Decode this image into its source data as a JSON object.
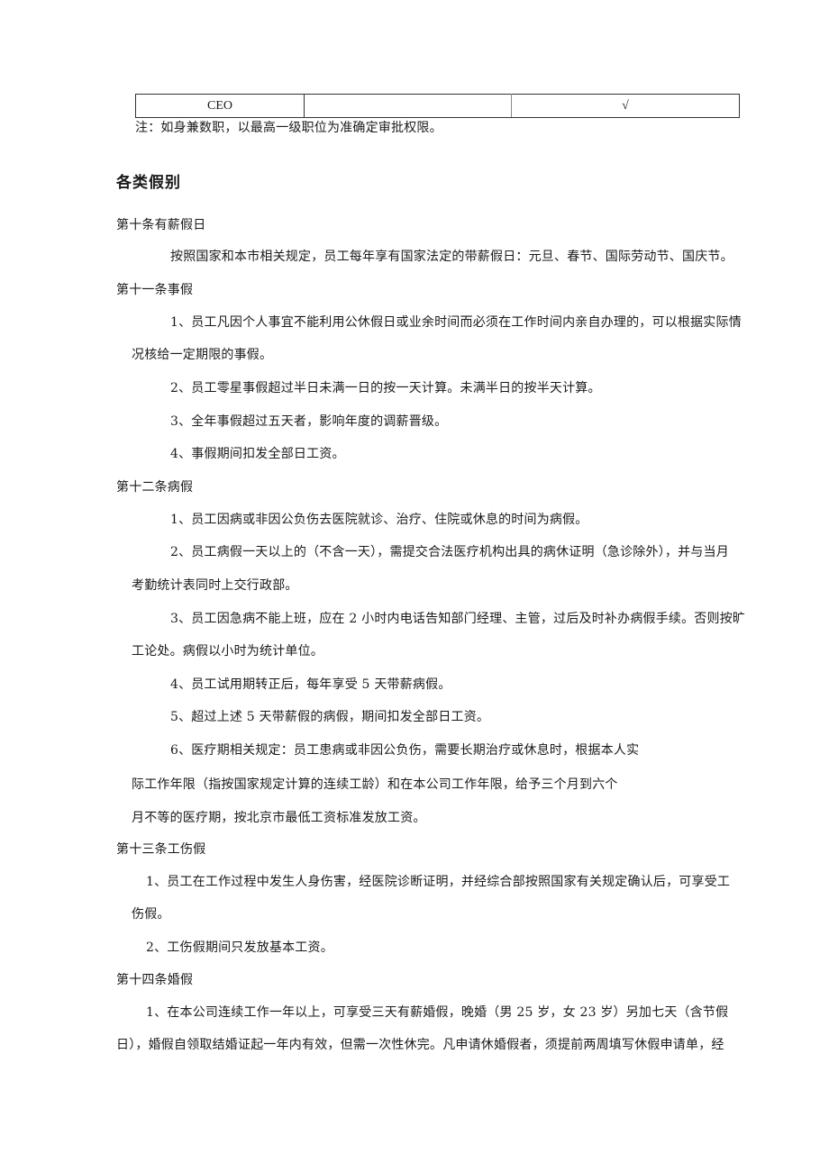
{
  "table": {
    "row": [
      "CEO",
      "",
      "√"
    ]
  },
  "note": "注：如身兼数职，以最高一级职位为准确定审批权限。",
  "section_title": "各类假别",
  "articles": {
    "a10": {
      "title": "第十条有薪假日",
      "lines": [
        "按照国家和本市相关规定，员工每年享有国家法定的带薪假日：元旦、春节、国际劳动节、国庆节。"
      ]
    },
    "a11": {
      "title": "第十一条事假",
      "lines": [
        "1、员工凡因个人事宜不能利用公休假日或业余时间而必须在工作时间内亲自办理的，可以根据实际情",
        "况核给一定期限的事假。",
        "2、员工零星事假超过半日未满一日的按一天计算。未满半日的按半天计算。",
        "3、全年事假超过五天者，影响年度的调薪晋级。",
        "4、事假期间扣发全部日工资。"
      ]
    },
    "a12": {
      "title": "第十二条病假",
      "lines": [
        "1、员工因病或非因公负伤去医院就诊、治疗、住院或休息的时间为病假。",
        "2、员工病假一天以上的（不含一天），需提交合法医疗机构出具的病休证明（急诊除外），并与当月",
        "考勤统计表同时上交行政部。",
        "3、员工因急病不能上班，应在 2 小时内电话告知部门经理、主管，过后及时补办病假手续。否则按旷",
        "工论处。病假以小时为统计单位。",
        "4、员工试用期转正后，每年享受 5 天带薪病假。",
        "5、超过上述 5 天带薪假的病假，期间扣发全部日工资。",
        "6、医疗期相关规定：员工患病或非因公负伤，需要长期治疗或休息时，根据本人实",
        "际工作年限（指按国家规定计算的连续工龄）和在本公司工作年限，给予三个月到六个",
        "月不等的医疗期，按北京市最低工资标准发放工资。"
      ]
    },
    "a13": {
      "title": "第十三条工伤假",
      "lines": [
        "1、员工在工作过程中发生人身伤害，经医院诊断证明，并经综合部按照国家有关规定确认后，可享受工",
        "伤假。",
        "2、工伤假期间只发放基本工资。"
      ]
    },
    "a14": {
      "title": "第十四条婚假",
      "lines": [
        "1、在本公司连续工作一年以上，可享受三天有薪婚假，晚婚（男 25 岁，女 23 岁）另加七天（含节假",
        "日），婚假自领取结婚证起一年内有效，但需一次性休完。凡申请休婚假者，须提前两周填写休假申请单，经"
      ]
    }
  }
}
